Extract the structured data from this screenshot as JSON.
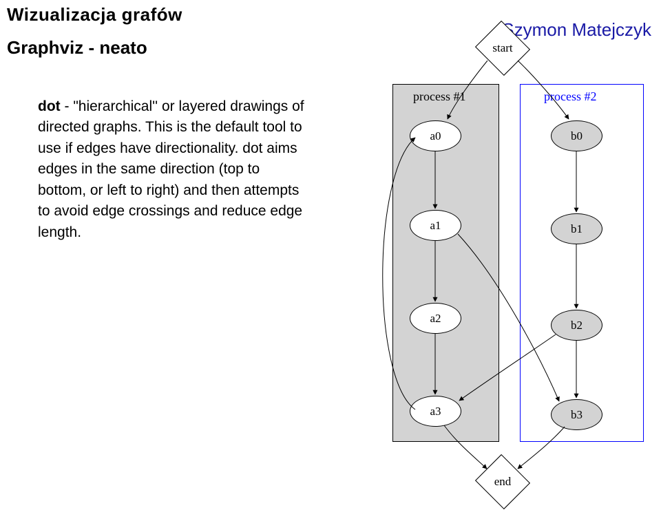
{
  "header": {
    "title": "Wizualizacja grafów",
    "subtitle": "Graphviz - neato",
    "author": "Szymon Matejczyk"
  },
  "body": {
    "tool_name": "dot",
    "description_rest": " - \"hierarchical'' or layered drawings of directed graphs. This is the default tool to use if edges have directionality. dot aims edges in the same direction (top to bottom, or left to right) and then attempts to avoid edge crossings and reduce edge length."
  },
  "diagram": {
    "start_label": "start",
    "end_label": "end",
    "cluster_a_label": "process #1",
    "cluster_b_label": "process #2",
    "nodes": {
      "a0": "a0",
      "a1": "a1",
      "a2": "a2",
      "a3": "a3",
      "b0": "b0",
      "b1": "b1",
      "b2": "b2",
      "b3": "b3"
    }
  }
}
